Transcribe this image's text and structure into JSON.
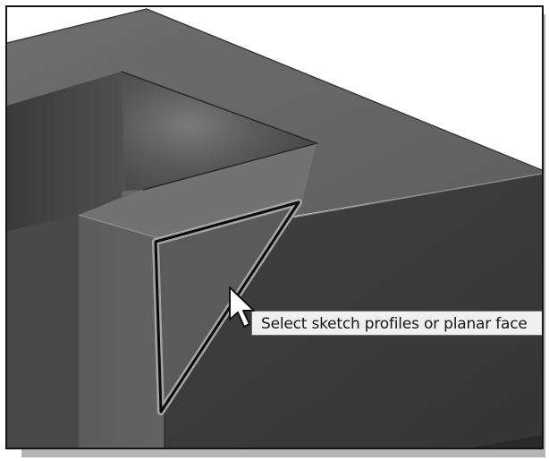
{
  "viewport": {
    "colors": {
      "top_face": "#6b6b6b",
      "front_face": "#3e3e3e",
      "pocket_wall": "#434343",
      "pocket_inner": "#585858",
      "highlight_edge": "#9a9a9a",
      "selected_face": "#5c5c5c",
      "selection_outline": "#a8a8a8"
    }
  },
  "tooltip": {
    "text": "Select sketch profiles or planar face"
  },
  "cursor": {
    "icon": "arrow-pointer-icon"
  }
}
